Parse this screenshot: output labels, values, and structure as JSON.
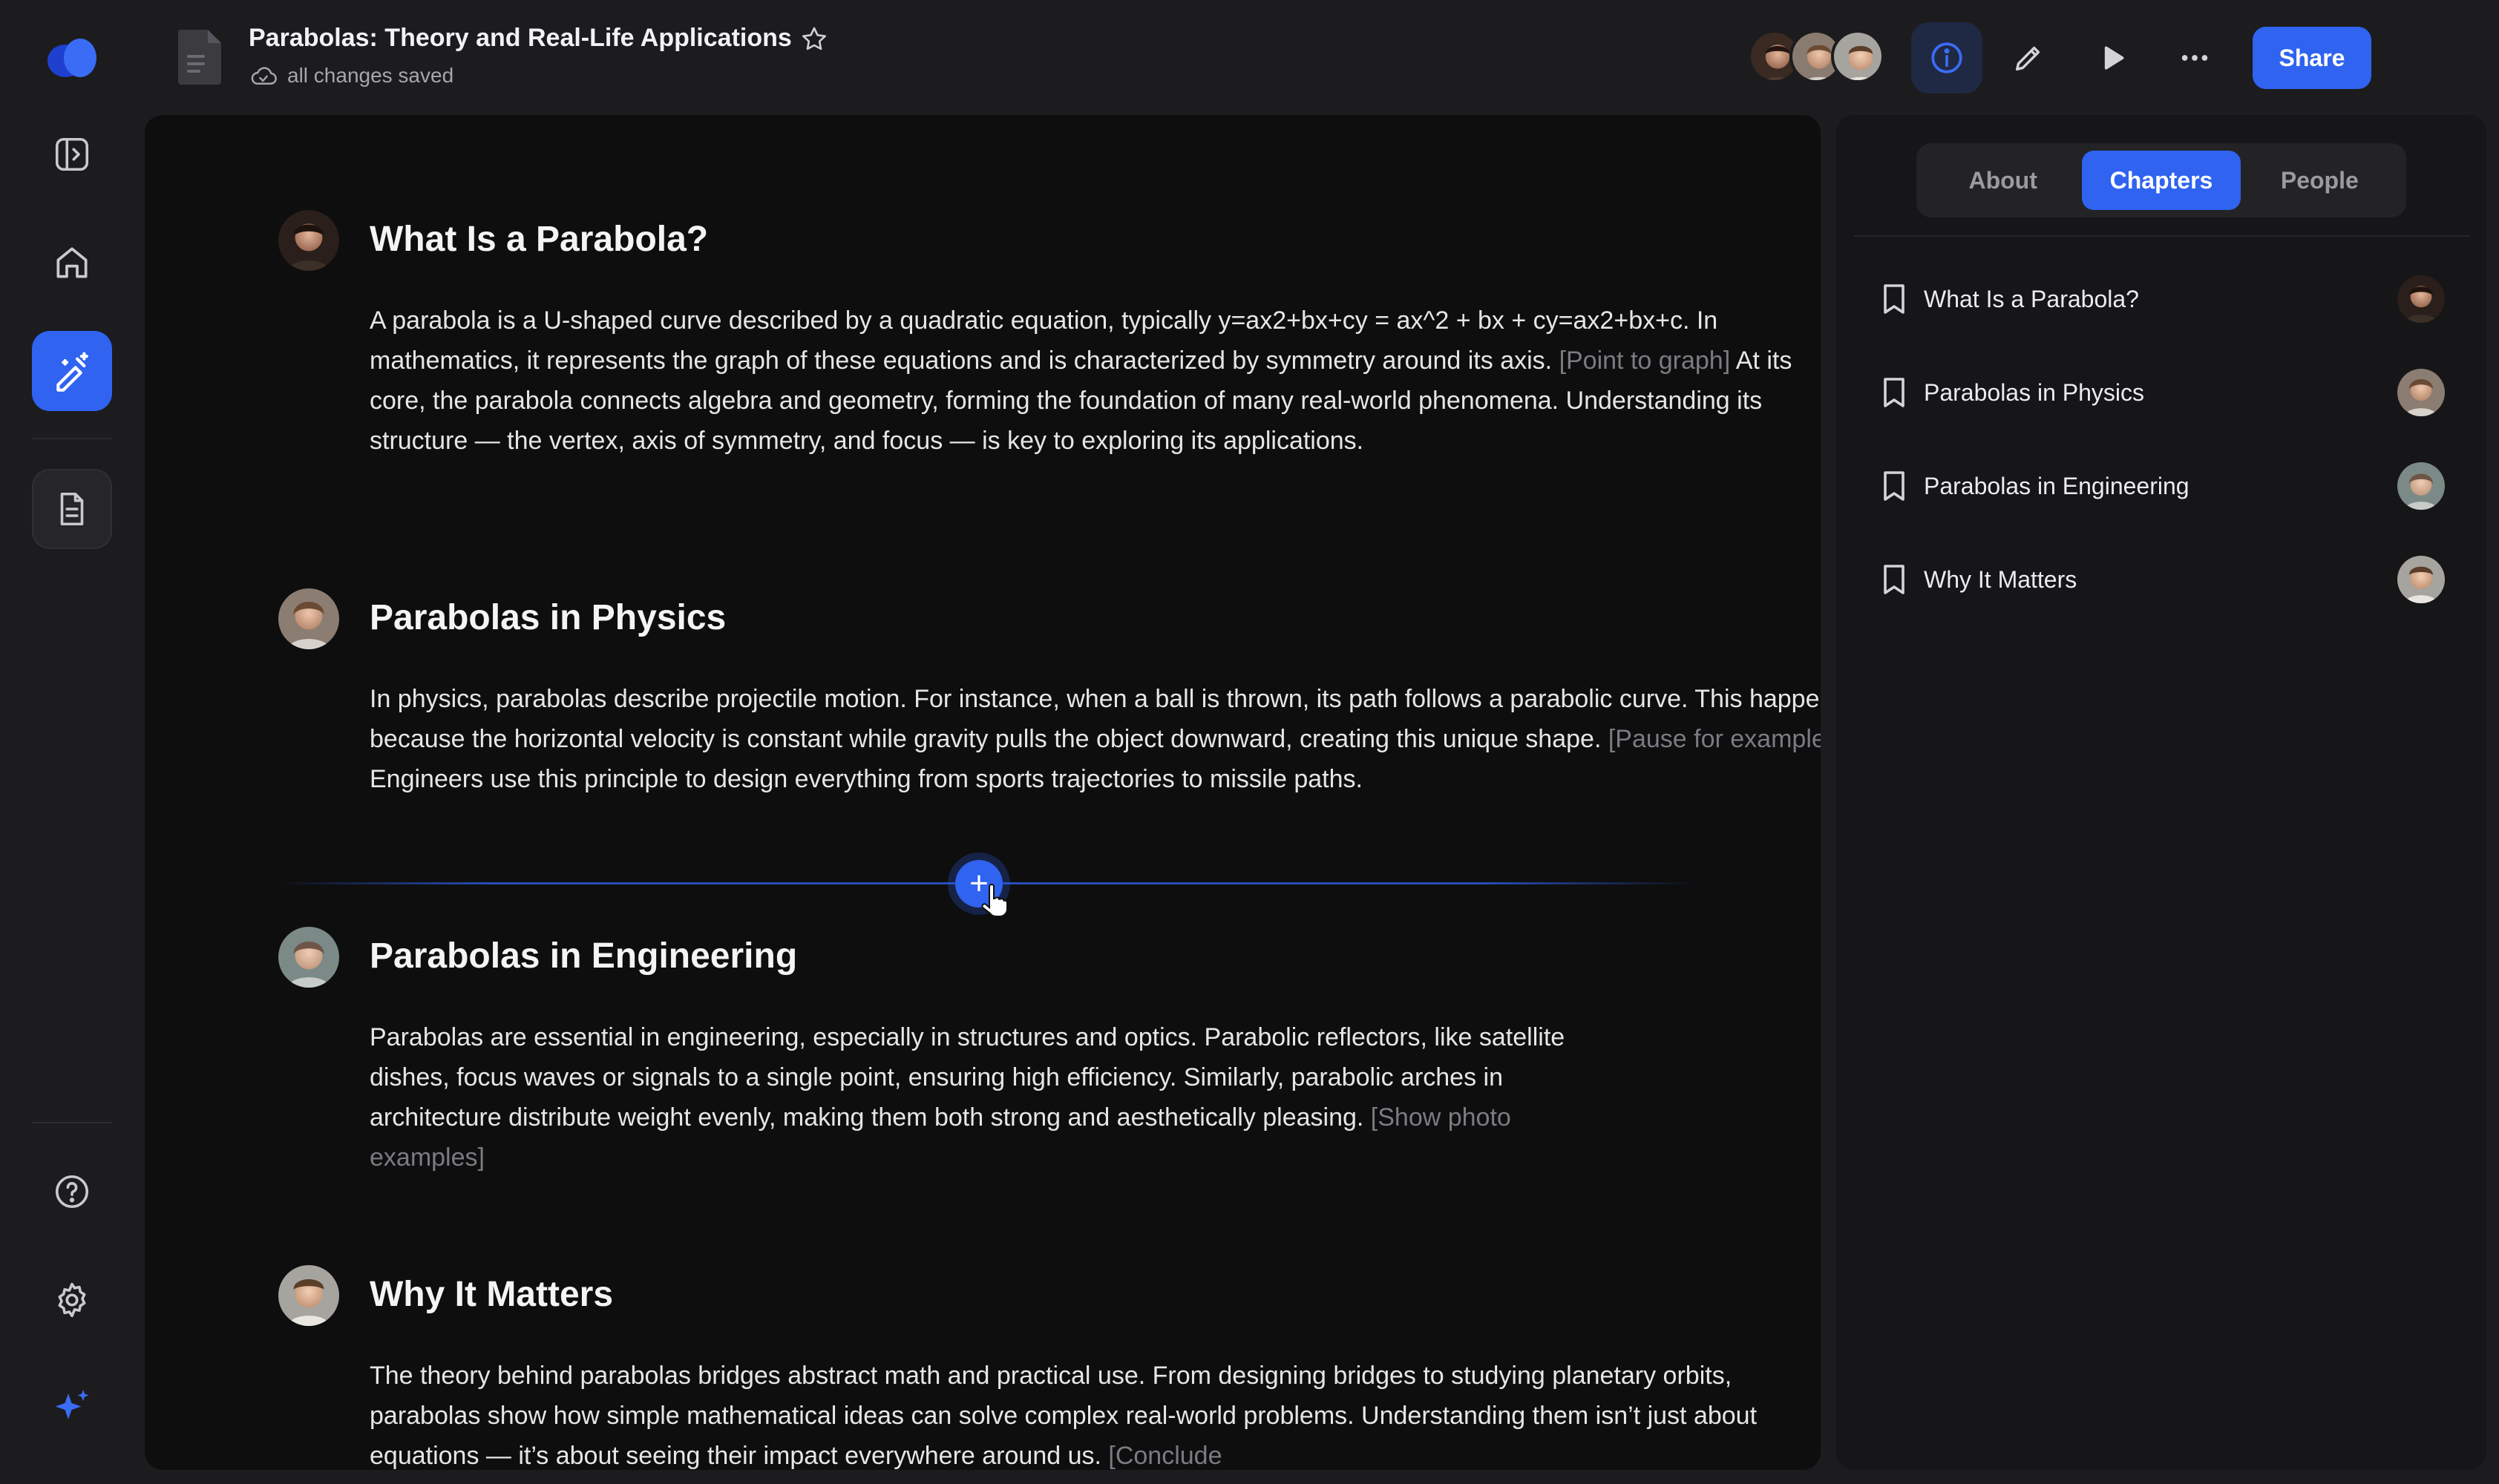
{
  "header": {
    "title": "Parabolas: Theory and Real-Life Applications",
    "save_status": "all changes saved",
    "share_label": "Share"
  },
  "sections": [
    {
      "title": "What Is a Parabola?",
      "body_before": "A parabola is a U-shaped curve described by a quadratic equation, typically y=ax2+bx+cy = ax^2 + bx + cy=ax2+bx+c. In mathematics, it represents the graph of these equations and is characterized by symmetry around its axis. ",
      "cue": "[Point to graph]",
      "body_after": " At its core, the parabola connects algebra and geometry, forming the foundation of many real-world phenomena. Understanding its structure — the vertex, axis of symmetry, and focus — is key to exploring its applications."
    },
    {
      "title": "Parabolas in Physics",
      "body_before": "In physics, parabolas describe projectile motion. For instance, when a ball is thrown, its path follows a parabolic curve. This happens because the horizontal velocity is constant while gravity pulls the object downward, creating this unique shape. ",
      "cue": "[Pause for example]",
      "body_after": " Engineers use this principle to design everything from sports trajectories to missile paths."
    },
    {
      "title": "Parabolas in Engineering",
      "body_before": "Parabolas are essential in engineering, especially in structures and optics. Parabolic reflectors, like satellite dishes, focus waves or signals to a single point, ensuring high efficiency. Similarly, parabolic arches in architecture distribute weight evenly, making them both strong and aesthetically pleasing. ",
      "cue": "[Show photo examples]",
      "body_after": ""
    },
    {
      "title": "Why It Matters",
      "body_before": "The theory behind parabolas bridges abstract math and practical use. From designing bridges to studying planetary orbits, parabolas show how simple mathematical ideas can solve complex real-world problems. Understanding them isn’t just about equations — it’s about seeing their impact everywhere around us. ",
      "cue": "[Conclude",
      "body_after": ""
    }
  ],
  "panel": {
    "tabs": [
      "About",
      "Chapters",
      "People"
    ],
    "active_tab": "Chapters",
    "chapters": [
      "What Is a Parabola?",
      "Parabolas in Physics",
      "Parabolas in Engineering",
      "Why It Matters"
    ]
  },
  "add_button_label": "+",
  "colors": {
    "accent": "#2f63f0",
    "background": "#1c1c1e",
    "editor_bg": "#0e0e0f",
    "panel_bg": "#161618",
    "cue_text": "#7b7b82"
  },
  "icons": {
    "rail": [
      "app-logo",
      "sidebar-toggle-icon",
      "home-icon",
      "magic-pen-icon",
      "document-icon",
      "help-icon",
      "settings-icon",
      "sparkle-icon"
    ],
    "header": [
      "document-icon",
      "star-icon",
      "cloud-icon",
      "info-icon",
      "pencil-icon",
      "play-icon",
      "more-icon"
    ],
    "panel": [
      "bookmark-icon"
    ]
  }
}
